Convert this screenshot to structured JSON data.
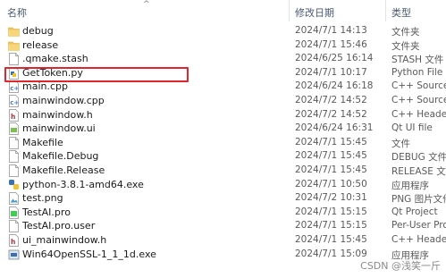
{
  "header": {
    "name": "名称",
    "date_modified": "修改日期",
    "type": "类型",
    "sort_indicator": "^"
  },
  "files": [
    {
      "name": "debug",
      "date": "2024/7/1 14:13",
      "type": "文件夹",
      "icon": "folder-icon"
    },
    {
      "name": "release",
      "date": "2024/7/1 15:46",
      "type": "文件夹",
      "icon": "folder-icon"
    },
    {
      "name": ".qmake.stash",
      "date": "2024/6/25 16:14",
      "type": "STASH 文件",
      "icon": "file-icon"
    },
    {
      "name": "GetToken.py",
      "date": "2024/7/1 10:17",
      "type": "Python File",
      "icon": "python-file-icon"
    },
    {
      "name": "main.cpp",
      "date": "2024/6/24 16:18",
      "type": "C++ Source",
      "icon": "cpp-source-icon"
    },
    {
      "name": "mainwindow.cpp",
      "date": "2024/7/2 14:52",
      "type": "C++ Source",
      "icon": "cpp-source-icon"
    },
    {
      "name": "mainwindow.h",
      "date": "2024/7/2 14:52",
      "type": "C++ Header",
      "icon": "cpp-header-icon"
    },
    {
      "name": "mainwindow.ui",
      "date": "2024/6/24 16:31",
      "type": "Qt UI file",
      "icon": "qt-ui-file-icon"
    },
    {
      "name": "Makefile",
      "date": "2024/7/1 15:45",
      "type": "文件",
      "icon": "file-icon"
    },
    {
      "name": "Makefile.Debug",
      "date": "2024/7/1 15:45",
      "type": "DEBUG 文件",
      "icon": "file-icon"
    },
    {
      "name": "Makefile.Release",
      "date": "2024/7/1 15:45",
      "type": "RELEASE 文件",
      "icon": "file-icon"
    },
    {
      "name": "python-3.8.1-amd64.exe",
      "date": "2024/7/1 10:50",
      "type": "应用程序",
      "icon": "python-installer-icon"
    },
    {
      "name": "test.png",
      "date": "2024/7/2 10:31",
      "type": "PNG 图片文件",
      "icon": "image-file-icon"
    },
    {
      "name": "TestAI.pro",
      "date": "2024/7/1 15:15",
      "type": "Qt Project",
      "icon": "qt-project-icon"
    },
    {
      "name": "TestAI.pro.user",
      "date": "2024/7/1 15:15",
      "type": "Per-User Pro",
      "icon": "file-icon"
    },
    {
      "name": "ui_mainwindow.h",
      "date": "2024/7/1 15:45",
      "type": "C++ Header",
      "icon": "cpp-header-icon"
    },
    {
      "name": "Win64OpenSSL-1_1_1d.exe",
      "date": "2024/7/1 15:09",
      "type": "应用程序",
      "icon": "installer-icon"
    }
  ],
  "watermark": "CSDN @浅笑一斤",
  "colors": {
    "highlight_border": "#e0262c",
    "folder": "#f2c55c",
    "cpp": "#4a7fc8",
    "header_text": "#4a5a74"
  }
}
